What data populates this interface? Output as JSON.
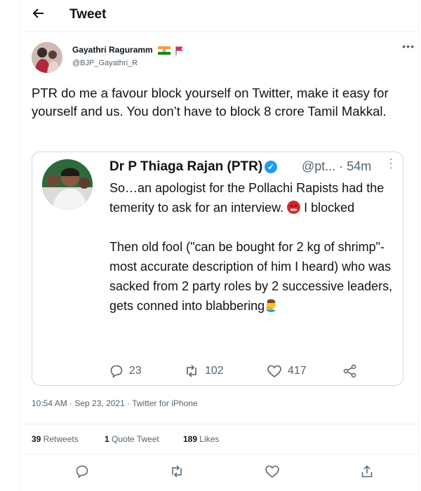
{
  "header": {
    "back_icon": "arrow-left-icon",
    "title": "Tweet"
  },
  "tweet": {
    "author": {
      "name": "Gayathri Raguramm",
      "handle": "@BJP_Gayathri_R"
    },
    "text": "PTR do me a favour block yourself on Twitter, make it easy for yourself and us. You don’t have to block 8 crore Tamil Makkal.",
    "timestamp": "10:54 AM · Sep 23, 2021 · Twitter for iPhone"
  },
  "quote": {
    "name": "Dr P Thiaga Rajan (PTR)",
    "handle_time": "@pt... · 54m",
    "para1": "So…an apologist for the Pollachi Rapists had the temerity to ask for an interview.",
    "para1_end": "I blocked",
    "para2": "Then old fool (\"can be bought for 2 kg of shrimp\"- most accurate description of him I heard) who was sacked from 2 party roles by 2 successive leaders, gets conned into blabbering",
    "replies": "23",
    "retweets": "102",
    "likes": "417"
  },
  "stats": {
    "retweets_count": "39",
    "retweets_label": "Retweets",
    "quotes_count": "1",
    "quotes_label": "Quote Tweet",
    "likes_count": "189",
    "likes_label": "Likes"
  },
  "colors": {
    "accent": "#1d9bf0",
    "muted": "#536471",
    "border": "#cfd9de"
  }
}
